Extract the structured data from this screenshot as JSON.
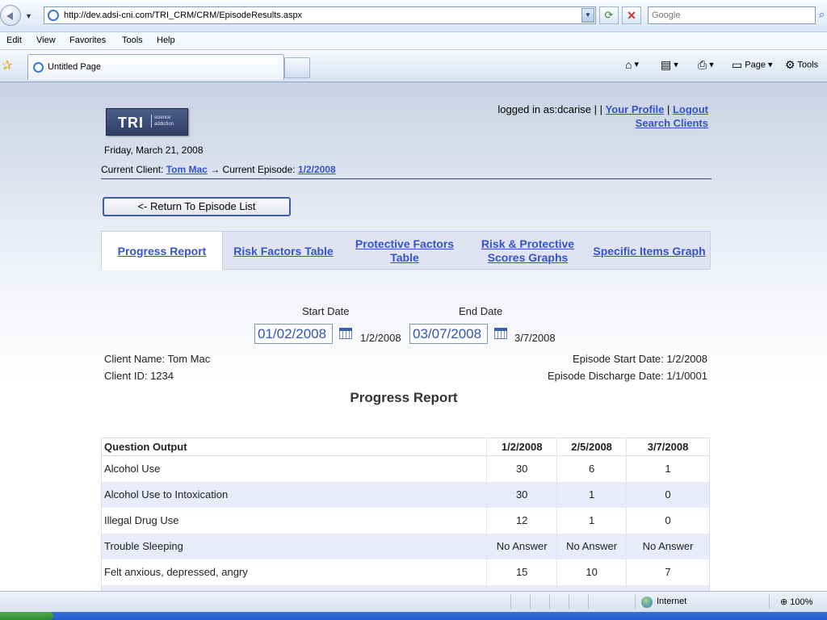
{
  "browser": {
    "url": "http://dev.adsi-cni.com/TRI_CRM/CRM/EpisodeResults.aspx",
    "search_placeholder": "Google",
    "menu": [
      "Edit",
      "View",
      "Favorites",
      "Tools",
      "Help"
    ],
    "tab_title": "Untitled Page",
    "commands": {
      "page": "Page",
      "tools": "Tools"
    },
    "status": {
      "zone": "Internet",
      "zoom": "100%"
    }
  },
  "logo": {
    "text": "TRI",
    "tagline": "science addiction"
  },
  "login": {
    "prefix": "logged in as:dcarise | |",
    "your_profile": "Your Profile",
    "separator": "|",
    "logout": "Logout",
    "search_clients": "Search Clients"
  },
  "header": {
    "date": "Friday, March 21, 2008",
    "current_client_label": "Current Client:",
    "client_name": "Tom Mac",
    "arrow": "→",
    "current_episode_label": "Current Episode:",
    "episode": "1/2/2008"
  },
  "return_button": "<- Return To Episode List",
  "nav": {
    "progress_report": "Progress Report",
    "risk_factors": "Risk Factors Table",
    "protective_factors": "Protective Factors Table",
    "risk_protective_graphs": "Risk & Protective Scores Graphs",
    "specific_items": "Specific Items Graph"
  },
  "filters": {
    "start_label": "Start Date",
    "end_label": "End Date",
    "start_value": "01/02/2008",
    "start_text": "1/2/2008",
    "end_value": "03/07/2008",
    "end_text": "3/7/2008"
  },
  "client_info": {
    "name": "Client Name: Tom Mac",
    "id": "Client ID: 1234",
    "episode_start": "Episode Start Date: 1/2/2008",
    "episode_discharge": "Episode Discharge Date: 1/1/0001"
  },
  "report_title": "Progress Report",
  "table": {
    "headers": [
      "Question Output",
      "1/2/2008",
      "2/5/2008",
      "3/7/2008"
    ],
    "rows": [
      [
        "Alcohol Use",
        "30",
        "6",
        "1"
      ],
      [
        "Alcohol Use to Intoxication",
        "30",
        "1",
        "0"
      ],
      [
        "Illegal Drug Use",
        "12",
        "1",
        "0"
      ],
      [
        "Trouble Sleeping",
        "No Answer",
        "No Answer",
        "No Answer"
      ],
      [
        "Felt anxious, depressed, angry",
        "15",
        "10",
        "7"
      ]
    ]
  }
}
